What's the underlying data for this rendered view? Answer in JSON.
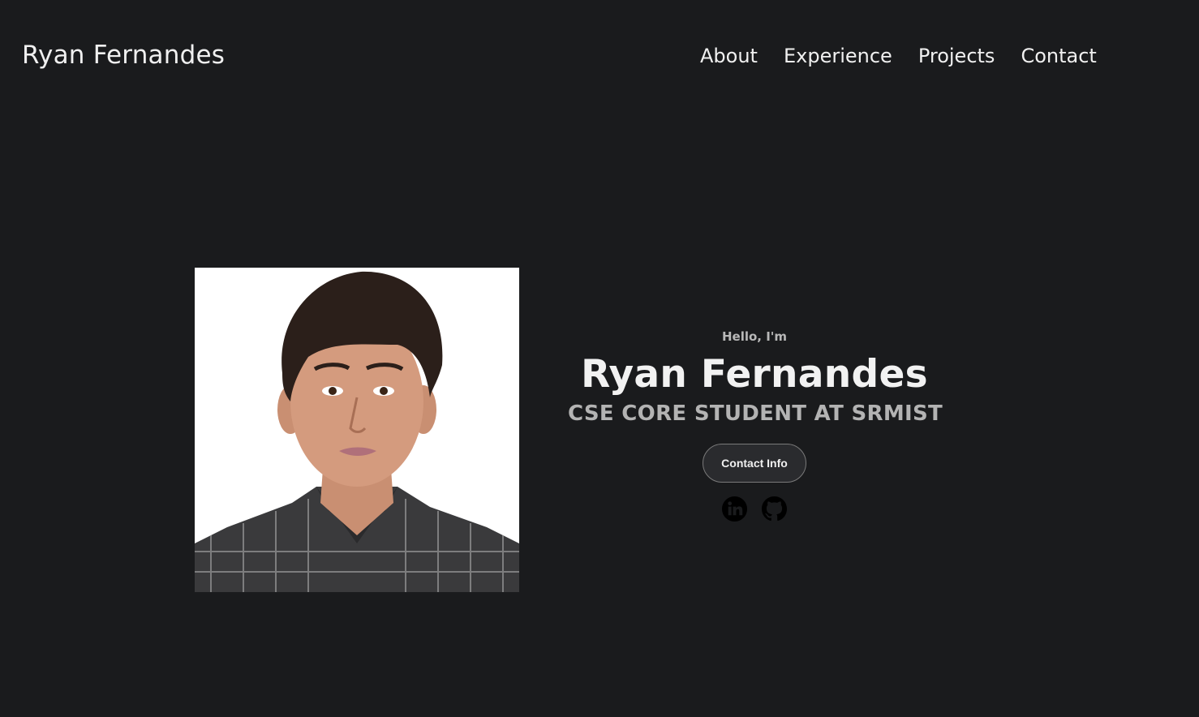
{
  "header": {
    "logo": "Ryan Fernandes",
    "nav": [
      {
        "label": "About"
      },
      {
        "label": "Experience"
      },
      {
        "label": "Projects"
      },
      {
        "label": "Contact"
      }
    ]
  },
  "hero": {
    "greeting": "Hello, I'm",
    "name": "Ryan Fernandes",
    "subtitle": "CSE CORE STUDENT AT SRMIST",
    "contact_button": "Contact Info",
    "socials": [
      {
        "icon": "linkedin-icon"
      },
      {
        "icon": "github-icon"
      }
    ]
  },
  "colors": {
    "background": "#1a1b1d",
    "text": "#f0f0f0",
    "muted": "#b3b3b3"
  }
}
